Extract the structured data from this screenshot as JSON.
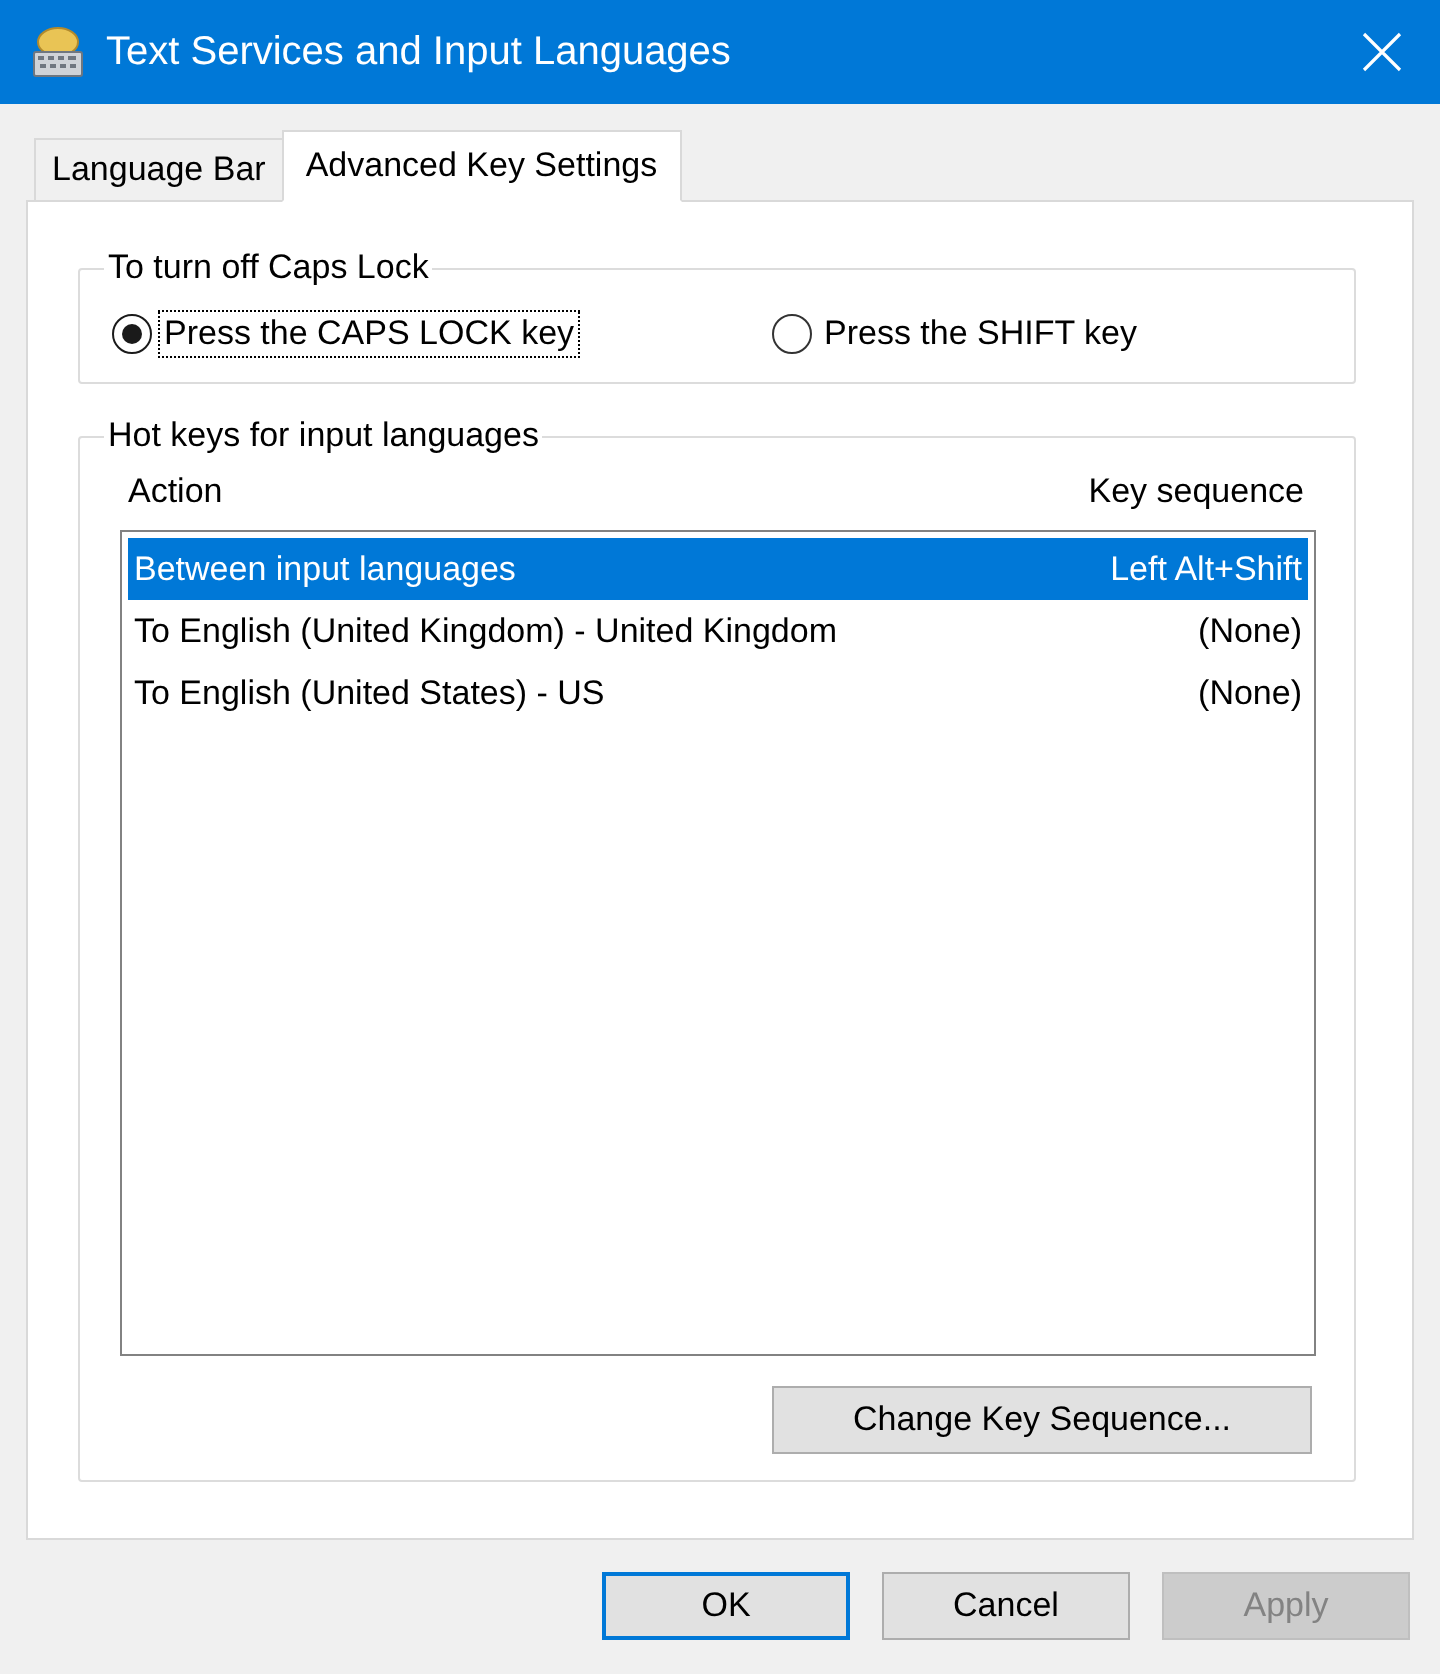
{
  "window": {
    "title": "Text Services and Input Languages"
  },
  "tabs": [
    {
      "label": "Language Bar",
      "selected": false
    },
    {
      "label": "Advanced Key Settings",
      "selected": true
    }
  ],
  "caps_lock": {
    "title": "To turn off Caps Lock",
    "options": [
      {
        "label": "Press the CAPS LOCK key",
        "selected": true,
        "focused": true
      },
      {
        "label": "Press the SHIFT key",
        "selected": false,
        "focused": false
      }
    ]
  },
  "hot_keys": {
    "title": "Hot keys for input languages",
    "columns": [
      "Action",
      "Key sequence"
    ],
    "rows": [
      {
        "action": "Between input languages",
        "key_sequence": "Left Alt+Shift",
        "selected": true
      },
      {
        "action": "To English (United Kingdom) - United Kingdom",
        "key_sequence": "(None)",
        "selected": false
      },
      {
        "action": "To English (United States) - US",
        "key_sequence": "(None)",
        "selected": false
      }
    ],
    "button": "Change Key Sequence..."
  },
  "buttons": [
    {
      "label": "OK",
      "default": true,
      "disabled": false
    },
    {
      "label": "Cancel",
      "default": false,
      "disabled": false
    },
    {
      "label": "Apply",
      "default": false,
      "disabled": true
    }
  ]
}
